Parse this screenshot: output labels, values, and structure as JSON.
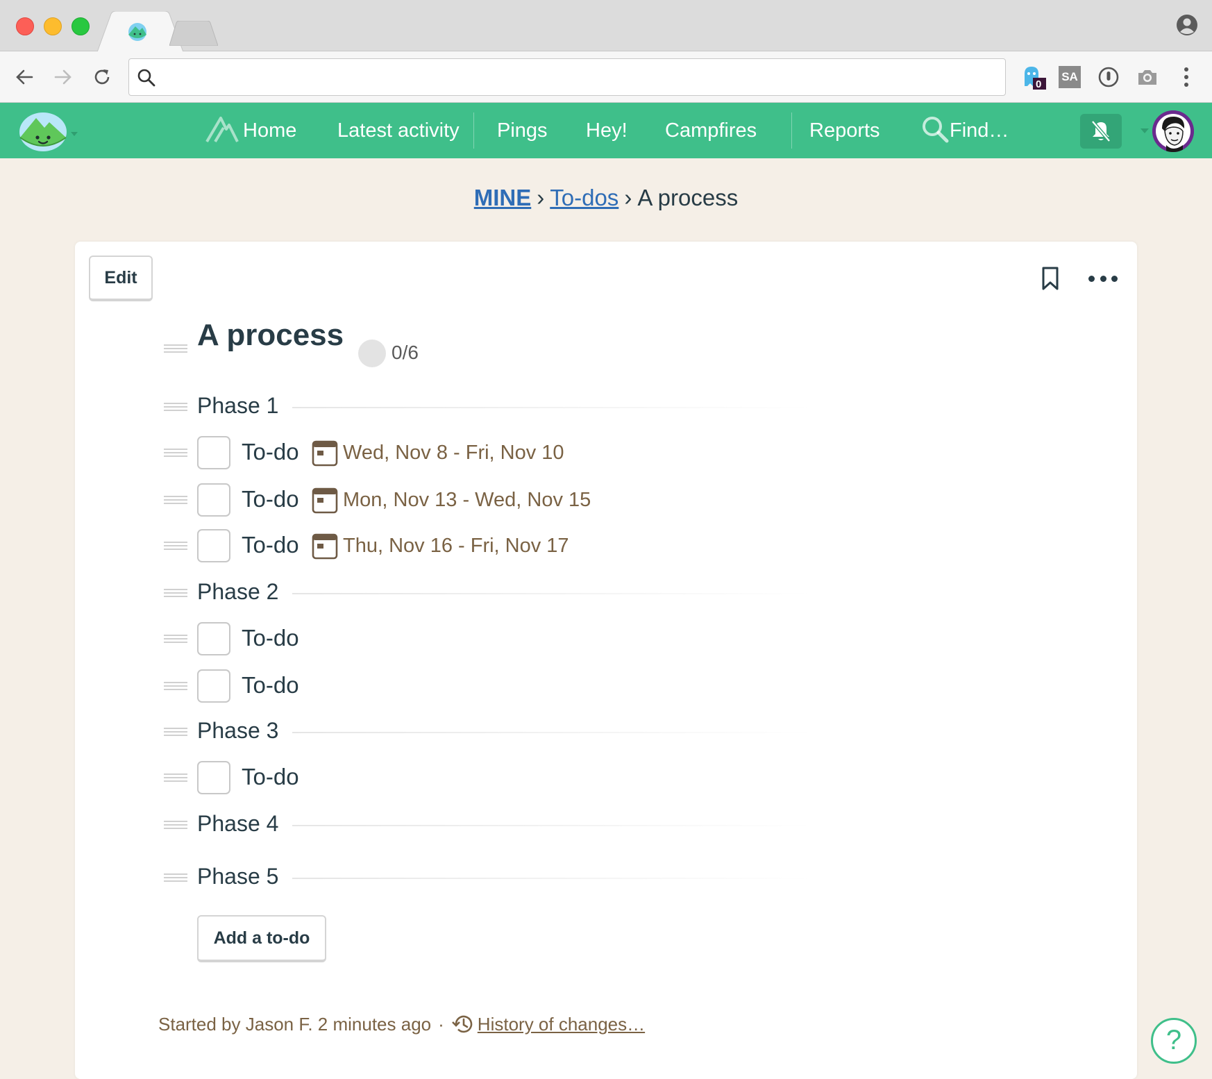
{
  "browser": {
    "address_bar": {
      "value": "",
      "placeholder": ""
    },
    "extensions": {
      "ghost_badge": "0",
      "sa_label": "SA"
    }
  },
  "nav": {
    "items": [
      {
        "label": "Home"
      },
      {
        "label": "Latest activity"
      },
      {
        "label": "Pings"
      },
      {
        "label": "Hey!"
      },
      {
        "label": "Campfires"
      },
      {
        "label": "Reports"
      },
      {
        "label": "Find…"
      }
    ],
    "colors": {
      "bar": "#3fbf8a",
      "bell_button": "#33a577"
    }
  },
  "breadcrumb": {
    "crumbs": [
      "MINE",
      "To-dos"
    ],
    "separator": "›",
    "current": "A process"
  },
  "card": {
    "edit_label": "Edit",
    "title": "A process",
    "progress": "0/6",
    "groups": [
      {
        "label": "Phase 1",
        "todos": [
          {
            "label": "To-do",
            "dates": "Wed, Nov 8 - Fri, Nov 10"
          },
          {
            "label": "To-do",
            "dates": "Mon, Nov 13 - Wed, Nov 15"
          },
          {
            "label": "To-do",
            "dates": "Thu, Nov 16 - Fri, Nov 17"
          }
        ]
      },
      {
        "label": "Phase 2",
        "todos": [
          {
            "label": "To-do"
          },
          {
            "label": "To-do"
          }
        ]
      },
      {
        "label": "Phase 3",
        "todos": [
          {
            "label": "To-do"
          }
        ]
      },
      {
        "label": "Phase 4",
        "todos": []
      },
      {
        "label": "Phase 5",
        "todos": []
      }
    ],
    "add_todo_label": "Add a to-do",
    "footer": {
      "started_by": "Started by Jason F. 2 minutes ago",
      "dot": "·",
      "history_link": "History of changes…"
    }
  },
  "help_label": "?"
}
